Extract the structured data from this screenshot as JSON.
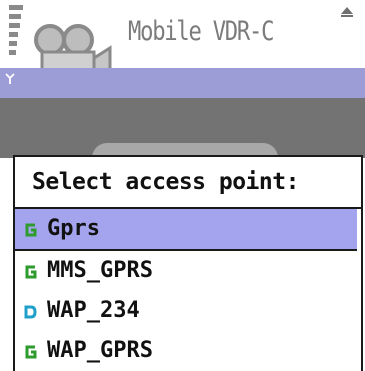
{
  "app": {
    "title": "Mobile VDR-C"
  },
  "status": {
    "signal_bars": 6,
    "antenna_icon": "antenna-icon"
  },
  "dialog": {
    "title": "Select access point:",
    "items": [
      {
        "label": "Gprs",
        "type": "gprs",
        "icon": "gprs-icon",
        "selected": true
      },
      {
        "label": "MMS_GPRS",
        "type": "gprs",
        "icon": "gprs-icon",
        "selected": false
      },
      {
        "label": "WAP_234",
        "type": "data",
        "icon": "data-call-icon",
        "selected": false
      },
      {
        "label": "WAP_GPRS",
        "type": "gprs",
        "icon": "gprs-icon",
        "selected": false
      }
    ]
  },
  "colors": {
    "header_band": "#9c9cd7",
    "selection": "#a4a4ee",
    "gprs_icon": "#2e9b2e",
    "data_icon": "#1ea0c8",
    "content_bg": "#737373"
  }
}
